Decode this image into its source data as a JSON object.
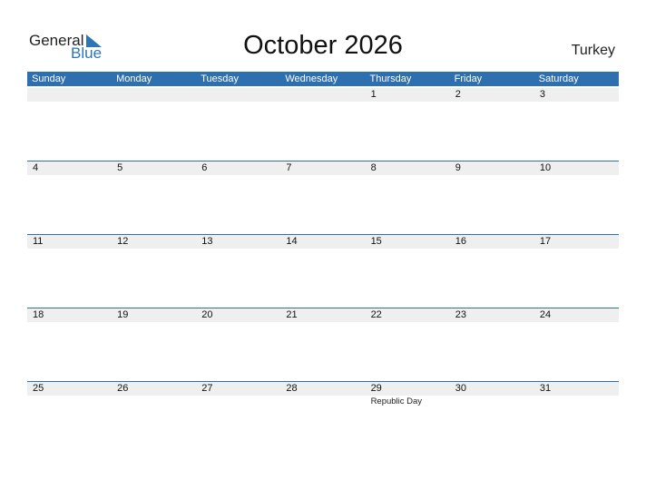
{
  "logo": {
    "general": "General",
    "blue": "Blue",
    "accent_color": "#2e75b6"
  },
  "title": "October 2026",
  "country": "Turkey",
  "header_color": "#2e6fb0",
  "weekdays": [
    "Sunday",
    "Monday",
    "Tuesday",
    "Wednesday",
    "Thursday",
    "Friday",
    "Saturday"
  ],
  "weeks": [
    [
      "",
      "",
      "",
      "",
      "1",
      "2",
      "3"
    ],
    [
      "4",
      "5",
      "6",
      "7",
      "8",
      "9",
      "10"
    ],
    [
      "11",
      "12",
      "13",
      "14",
      "15",
      "16",
      "17"
    ],
    [
      "18",
      "19",
      "20",
      "21",
      "22",
      "23",
      "24"
    ],
    [
      "25",
      "26",
      "27",
      "28",
      "29",
      "30",
      "31"
    ]
  ],
  "holidays": [
    {
      "day": "29",
      "name": "Republic Day"
    }
  ]
}
